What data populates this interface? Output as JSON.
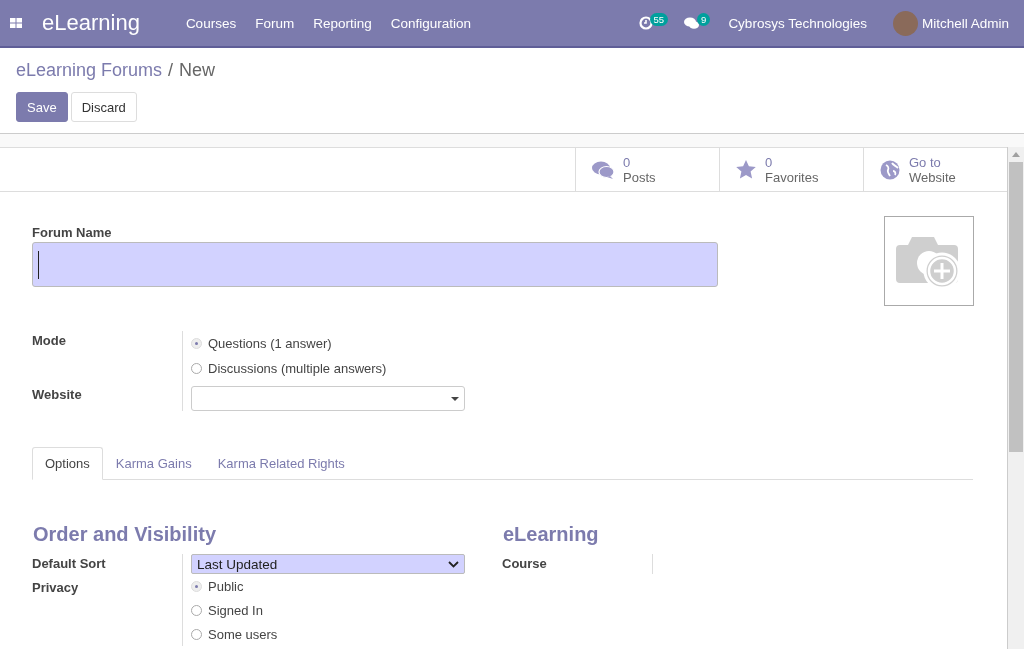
{
  "navbar": {
    "app_name": "eLearning",
    "menu": [
      "Courses",
      "Forum",
      "Reporting",
      "Configuration"
    ],
    "activity_count": "55",
    "message_count": "9",
    "company": "Cybrosys Technologies",
    "user": "Mitchell Admin"
  },
  "breadcrumb": {
    "parent": "eLearning Forums",
    "separator": "/",
    "current": "New"
  },
  "buttons": [
    {
      "label": "Save",
      "kind": "primary"
    },
    {
      "label": "Discard",
      "kind": "secondary"
    }
  ],
  "stat_buttons": [
    {
      "value": "0",
      "label": "Posts",
      "kind": "posts"
    },
    {
      "value": "0",
      "label": "Favorites",
      "kind": "favorites"
    },
    {
      "value": "Go to",
      "label": "Website",
      "kind": "website"
    }
  ],
  "forum_name": {
    "label": "Forum Name"
  },
  "mode": {
    "label": "Mode",
    "options": [
      {
        "label": "Questions (1 answer)",
        "selected": true
      },
      {
        "label": "Discussions (multiple answers)",
        "selected": false
      }
    ]
  },
  "website": {
    "label": "Website"
  },
  "tabs": [
    {
      "label": "Options",
      "selected": true
    },
    {
      "label": "Karma Gains",
      "selected": false
    },
    {
      "label": "Karma Related Rights",
      "selected": false
    }
  ],
  "order_section": {
    "title": "Order and Visibility",
    "default_sort": {
      "label": "Default Sort",
      "value": "Last Updated"
    },
    "privacy": {
      "label": "Privacy",
      "options": [
        {
          "label": "Public",
          "selected": true
        },
        {
          "label": "Signed In",
          "selected": false
        },
        {
          "label": "Some users",
          "selected": false
        }
      ]
    }
  },
  "elearning_section": {
    "title": "eLearning",
    "course": {
      "label": "Course"
    }
  }
}
